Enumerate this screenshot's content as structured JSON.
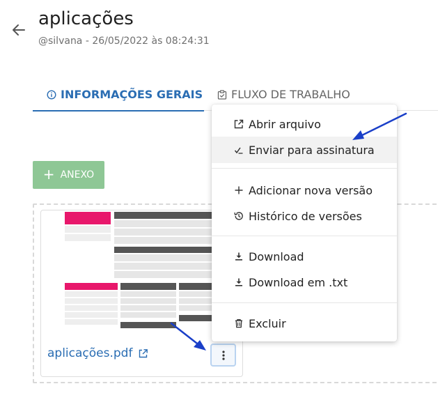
{
  "header": {
    "title": "aplicações",
    "subtitle": "@silvana - 26/05/2022 às 08:24:31"
  },
  "tabs": [
    {
      "label": "INFORMAÇÕES GERAIS",
      "icon": "info-circle-icon",
      "active": true
    },
    {
      "label": "FLUXO DE TRABALHO",
      "icon": "clipboard-check-icon",
      "active": false
    }
  ],
  "anexo_button": {
    "label": "ANEXO",
    "color": "#8ec795"
  },
  "file": {
    "name": "aplicações.pdf"
  },
  "menu": {
    "items": [
      {
        "label": "Abrir arquivo",
        "icon": "external-link-icon"
      },
      {
        "label": "Enviar para assinatura",
        "icon": "signature-icon"
      },
      {
        "label": "Adicionar nova versão",
        "icon": "plus-icon"
      },
      {
        "label": "Histórico de versões",
        "icon": "history-icon"
      },
      {
        "label": "Download",
        "icon": "download-icon"
      },
      {
        "label": "Download em .txt",
        "icon": "download-icon"
      },
      {
        "label": "Excluir",
        "icon": "trash-icon"
      }
    ]
  },
  "colors": {
    "accent": "#2a6db3",
    "annotation_arrow": "#1a3fc8",
    "thumbnail_highlight": "#e8176b"
  }
}
